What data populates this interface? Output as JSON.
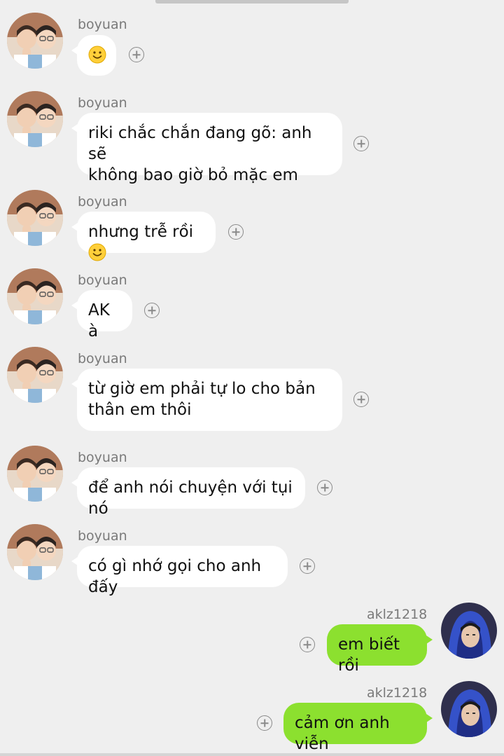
{
  "messages": [
    {
      "sender": "boyuan",
      "text": "",
      "emoji": "smile-emoji"
    },
    {
      "sender": "boyuan",
      "line1": "riki chắc chắn đang gõ: anh sẽ",
      "line2": "không bao giờ bỏ mặc em"
    },
    {
      "sender": "boyuan",
      "text": "nhưng trễ rồi",
      "emoji": "smile-emoji"
    },
    {
      "sender": "boyuan",
      "text": "AK à"
    },
    {
      "sender": "boyuan",
      "line1": "từ giờ em phải tự lo cho bản",
      "line2": "thân em thôi"
    },
    {
      "sender": "boyuan",
      "text": "để anh nói chuyện với tụi nó"
    },
    {
      "sender": "boyuan",
      "text": "có gì nhớ gọi cho anh đấy"
    },
    {
      "sender": "aklz1218",
      "text": "em biết rồi"
    },
    {
      "sender": "aklz1218",
      "text": "cảm ơn anh viễn"
    }
  ],
  "colors": {
    "outgoing": "#8ce02f",
    "incoming": "#ffffff",
    "background": "#efefef"
  },
  "icons": {
    "add": "plus-circle-icon",
    "emoji": "smile-emoji"
  }
}
